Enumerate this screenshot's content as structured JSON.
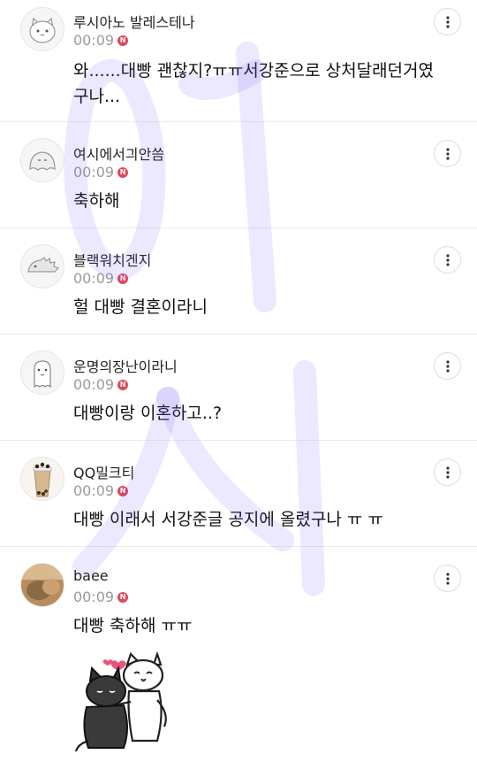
{
  "comments": [
    {
      "nickname": "루시아노 발레스테나",
      "time": "00:09",
      "badge": "N",
      "text": "와......대빵 괜찮지?ㅠㅠ서강준으로 상처달래던거였구나...",
      "avatar": "cat-face-avatar"
    },
    {
      "nickname": "여시에서긔안씀",
      "time": "00:09",
      "badge": "N",
      "text": "축하해",
      "avatar": "ghost-blob-avatar"
    },
    {
      "nickname": "블랙워치겐지",
      "time": "00:09",
      "badge": "N",
      "text": "헐 대빵 결혼이라니",
      "avatar": "hedgehog-avatar"
    },
    {
      "nickname": "운명의장난이라니",
      "time": "00:09",
      "badge": "N",
      "text": "대빵이랑 이혼하고..?",
      "avatar": "ghost-avatar"
    },
    {
      "nickname": "QQ밀크티",
      "time": "00:09",
      "badge": "N",
      "text": "대빵 이래서 서강준글 공지에 올렸구나 ㅠ ㅠ",
      "avatar": "bubble-tea-avatar"
    },
    {
      "nickname": "baee",
      "time": "00:09",
      "badge": "N",
      "text": "대빵 축하해 ㅠㅠ",
      "avatar": "photo-avatar"
    }
  ],
  "sticker": "hugging-cats-sticker",
  "colors": {
    "badge": "#e0485b",
    "watermark": "#6f4bff"
  }
}
